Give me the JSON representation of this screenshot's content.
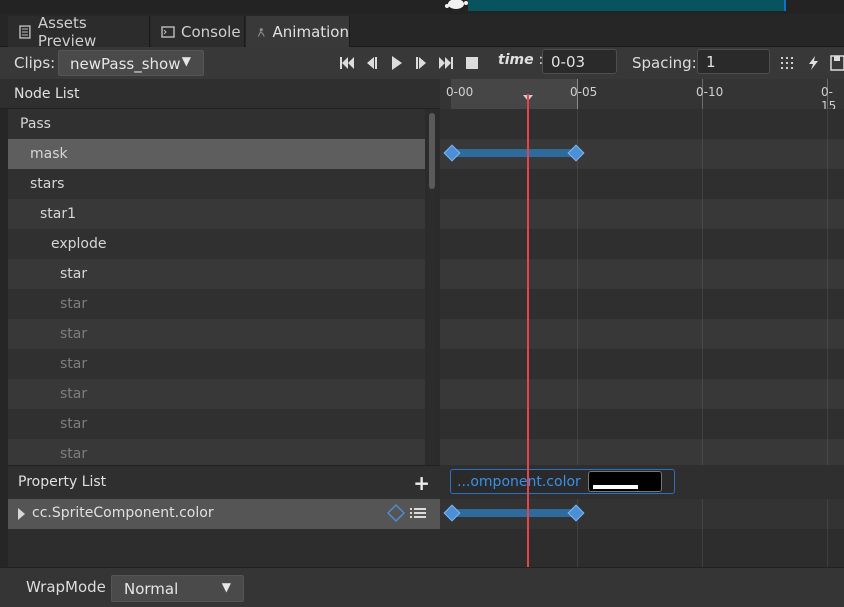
{
  "tabs": [
    {
      "label": "Assets Preview",
      "icon": "list-icon"
    },
    {
      "label": "Console",
      "icon": "terminal-icon"
    },
    {
      "label": "Animation",
      "icon": "animation-icon"
    }
  ],
  "toolbar": {
    "clips_label": "Clips:",
    "clip_value": "newPass_show",
    "time_label": "time",
    "time_colon": ":",
    "time_value": "0-03",
    "spacing_label": "Spacing:",
    "spacing_value": "1",
    "controls": [
      "jump-to-start-icon",
      "prev-frame-icon",
      "play-icon",
      "next-frame-icon",
      "jump-to-end-icon",
      "stop-icon",
      "grid-icon",
      "event-icon",
      "save-icon"
    ]
  },
  "node_list": {
    "title": "Node List",
    "nodes": [
      {
        "label": "Pass",
        "dim": false,
        "selected": false
      },
      {
        "label": "mask",
        "dim": false,
        "selected": true
      },
      {
        "label": "stars",
        "dim": false,
        "selected": false
      },
      {
        "label": "star1",
        "dim": false,
        "selected": false
      },
      {
        "label": "explode",
        "dim": false,
        "selected": false
      },
      {
        "label": "star",
        "dim": false,
        "selected": false
      },
      {
        "label": "star",
        "dim": true,
        "selected": false
      },
      {
        "label": "star",
        "dim": true,
        "selected": false
      },
      {
        "label": "star",
        "dim": true,
        "selected": false
      },
      {
        "label": "star",
        "dim": true,
        "selected": false
      },
      {
        "label": "star",
        "dim": true,
        "selected": false
      },
      {
        "label": "star",
        "dim": true,
        "selected": false
      }
    ]
  },
  "ruler": {
    "labels": [
      "0-00",
      "0-05",
      "0-10",
      "0-15"
    ]
  },
  "property_list": {
    "title": "Property List",
    "add_label": "+",
    "property": "cc.SpriteComponent.color",
    "field_label": "...omponent.color",
    "field_color": "#000000"
  },
  "bottom": {
    "wrapmode_label": "WrapMode",
    "wrapmode_value": "Normal"
  },
  "colors": {
    "keyframe": "#4b8fd6",
    "cursor": "#e2454b",
    "selected_row": "#5e5e5e"
  }
}
